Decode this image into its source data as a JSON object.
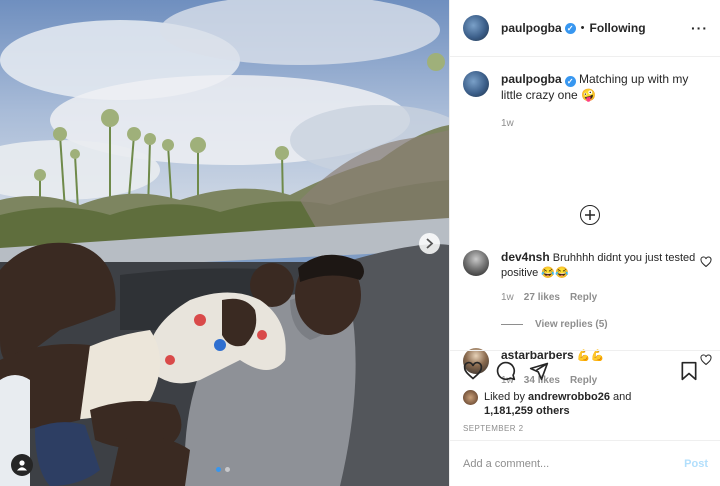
{
  "header": {
    "username": "paulpogba",
    "separator": "•",
    "follow_status": "Following",
    "more": "···"
  },
  "caption": {
    "username": "paulpogba",
    "text": "Matching up with my little crazy one 🤪",
    "time": "1w"
  },
  "comments": [
    {
      "username": "dev4nsh",
      "text": "Bruhhhh didnt you just tested positive 😂😂",
      "time": "1w",
      "likes": "27 likes",
      "reply": "Reply",
      "view_replies": "View replies (5)"
    },
    {
      "username": "astarbarbers",
      "text": "💪💪",
      "time": "1w",
      "likes": "34 likes",
      "reply": "Reply"
    }
  ],
  "likes": {
    "prefix": "Liked by",
    "user": "andrewrobbo26",
    "and": "and",
    "others": "1,181,259 others"
  },
  "date": "SEPTEMBER 2",
  "add_comment": {
    "placeholder": "Add a comment...",
    "post": "Post"
  },
  "carousel": {
    "slides": 2,
    "current": 1
  },
  "icons": [
    "verified-badge",
    "plus-circle-icon",
    "heart-icon",
    "comment-icon",
    "share-icon",
    "bookmark-icon",
    "chevron-right-icon",
    "user-tag-icon"
  ],
  "colors": {
    "verified": "#3897f0",
    "post_disabled": "#b2dffc",
    "secondary_text": "#8e8e8e",
    "carousel_active_dot": "#3797f0"
  }
}
